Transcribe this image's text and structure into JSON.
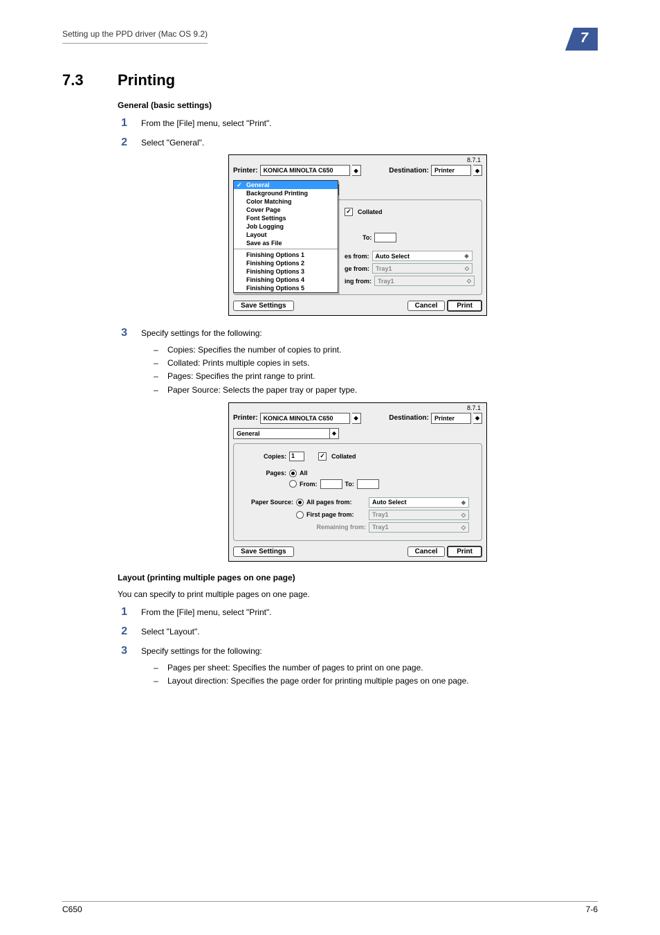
{
  "header": {
    "breadcrumb": "Setting up the PPD driver (Mac OS 9.2)",
    "chapter_num": "7"
  },
  "section": {
    "number": "7.3",
    "title": "Printing"
  },
  "general": {
    "heading": "General (basic settings)",
    "step1": "From the [File] menu, select \"Print\".",
    "step2": "Select \"General\".",
    "step3": "Specify settings for the following:",
    "bullets": {
      "b1": "Copies: Specifies the number of copies to print.",
      "b2": "Collated: Prints multiple copies in sets.",
      "b3": "Pages: Specifies the print range to print.",
      "b4": "Paper Source: Selects the paper tray or paper type."
    }
  },
  "dlg1": {
    "version": "8.7.1",
    "printer_label": "Printer:",
    "printer_value": "KONICA MINOLTA C650",
    "dest_label": "Destination:",
    "dest_value": "Printer",
    "panel_selected": "General",
    "dropdown": {
      "i0": "General",
      "i1": "Background Printing",
      "i2": "Color Matching",
      "i3": "Cover Page",
      "i4": "Font Settings",
      "i5": "Job Logging",
      "i6": "Layout",
      "i7": "Save as File",
      "i8": "Finishing Options 1",
      "i9": "Finishing Options 2",
      "i10": "Finishing Options 3",
      "i11": "Finishing Options 4",
      "i12": "Finishing Options 5"
    },
    "collated": "Collated",
    "to": "To:",
    "row_es": "es from:",
    "row_ge": "ge from:",
    "row_ing": "ing from:",
    "auto": "Auto Select",
    "tray1a": "Tray1",
    "tray1b": "Tray1",
    "save_settings": "Save Settings",
    "cancel": "Cancel",
    "print": "Print"
  },
  "dlg2": {
    "version": "8.7.1",
    "printer_label": "Printer:",
    "printer_value": "KONICA MINOLTA C650",
    "dest_label": "Destination:",
    "dest_value": "Printer",
    "panel_selected": "General",
    "copies_label": "Copies:",
    "copies_value": "1",
    "collated": "Collated",
    "pages_label": "Pages:",
    "all": "All",
    "from": "From:",
    "to": "To:",
    "paper_source": "Paper Source:",
    "all_pages_from": "All pages from:",
    "first_page_from": "First page from:",
    "remaining_from": "Remaining from:",
    "auto": "Auto Select",
    "tray1a": "Tray1",
    "tray1b": "Tray1",
    "save_settings": "Save Settings",
    "cancel": "Cancel",
    "print": "Print"
  },
  "layout": {
    "heading": "Layout (printing multiple pages on one page)",
    "intro": "You can specify to print multiple pages on one page.",
    "step1": "From the [File] menu, select \"Print\".",
    "step2": "Select \"Layout\".",
    "step3": "Specify settings for the following:",
    "bullets": {
      "b1": "Pages per sheet: Specifies the number of pages to print on one page.",
      "b2": "Layout direction: Specifies the page order for printing multiple pages on one page."
    }
  },
  "footer": {
    "left": "C650",
    "right": "7-6"
  }
}
